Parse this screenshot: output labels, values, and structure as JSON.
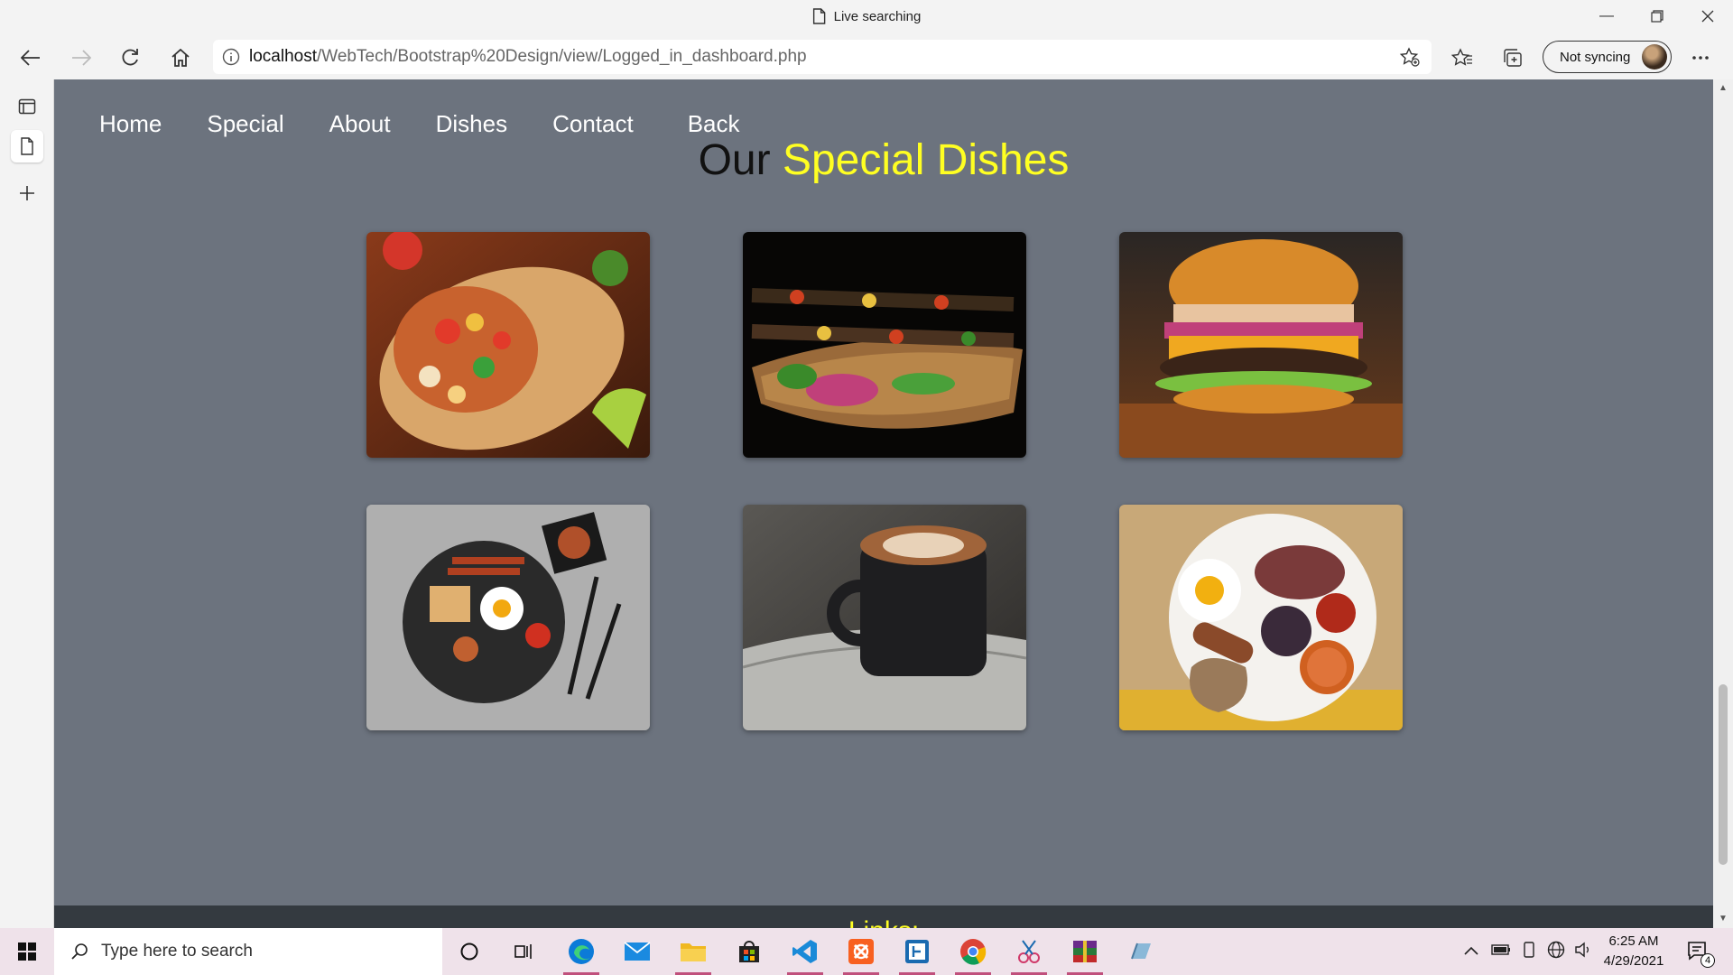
{
  "window": {
    "tab_title": "Live searching",
    "controls": [
      "minimize",
      "restore",
      "close"
    ]
  },
  "toolbar": {
    "url_host": "localhost",
    "url_path": "/WebTech/Bootstrap%20Design/view/Logged_in_dashboard.php",
    "sync_label": "Not syncing"
  },
  "page": {
    "nav": [
      "Home",
      "Special",
      "About",
      "Dishes",
      "Contact",
      "Back"
    ],
    "heading_part1": "Our",
    "heading_part2": "Special Dishes",
    "footer_label": "Links:",
    "colors": {
      "background": "#6c737e",
      "heading_accent": "#ffff22",
      "footer": "#343a40"
    },
    "dishes": [
      {
        "name": "burrito-image"
      },
      {
        "name": "kebab-skewers-image"
      },
      {
        "name": "burger-image"
      },
      {
        "name": "breakfast-plate-image"
      },
      {
        "name": "coffee-cup-image"
      },
      {
        "name": "english-breakfast-image"
      }
    ]
  },
  "taskbar": {
    "search_placeholder": "Type here to search",
    "time": "6:25 AM",
    "date": "4/29/2021",
    "notification_count": "4",
    "apps": [
      "cortana-icon",
      "task-view-icon",
      "edge-icon",
      "mail-icon",
      "file-explorer-icon",
      "store-icon",
      "vscode-icon",
      "xampp-icon",
      "app-icon",
      "chrome-icon",
      "snip-icon",
      "winrar-icon",
      "app-icon-2"
    ]
  }
}
